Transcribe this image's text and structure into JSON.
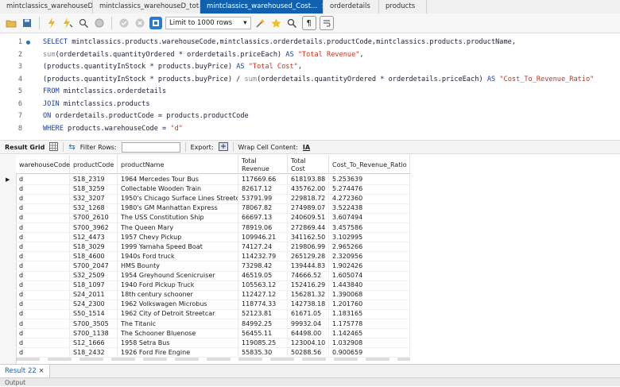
{
  "tabs": [
    {
      "label": "mintclassics_warehouseD",
      "close": ""
    },
    {
      "label": "mintclassics_warehouseD_total...",
      "close": ""
    },
    {
      "label": "mintclassics_warehoused_Cost...",
      "close": "×"
    },
    {
      "label": "orderdetails",
      "close": ""
    },
    {
      "label": "products",
      "close": ""
    }
  ],
  "toolbar": {
    "limit_label": "Limit to 1000 rows",
    "icons": [
      "folder-icon",
      "save-icon",
      "lightning-icon",
      "lightning-cursor-icon",
      "magnifier-icon",
      "stop-icon",
      "check-icon",
      "cancel-icon",
      "toggle-icon",
      "limit-dropdown",
      "beautify-icon",
      "star-icon",
      "search-icon",
      "invisible-chars-icon",
      "wrap-icon"
    ]
  },
  "editor": {
    "lines": [
      {
        "n": "1",
        "parts": [
          [
            "kw",
            "SELECT "
          ],
          [
            "t",
            "mintclassics.products.warehouseCode,mintclassics.orderdetails.productCode,mintclassics.products.productName,"
          ]
        ]
      },
      {
        "n": "2",
        "parts": [
          [
            "fn",
            "sum"
          ],
          [
            "t",
            "(orderdetails.quantityOrdered * orderdetails.priceEach) "
          ],
          [
            "kw",
            "AS "
          ],
          [
            "str",
            "\"Total Revenue\""
          ],
          [
            "t",
            ","
          ]
        ]
      },
      {
        "n": "3",
        "parts": [
          [
            "t",
            "(products.quantityInStock * products.buyPrice) "
          ],
          [
            "kw",
            "AS "
          ],
          [
            "str",
            "\"Total Cost\""
          ],
          [
            "t",
            ","
          ]
        ]
      },
      {
        "n": "4",
        "parts": [
          [
            "t",
            "(products.quantityInStock * products.buyPrice) / "
          ],
          [
            "fn",
            "sum"
          ],
          [
            "t",
            "(orderdetails.quantityOrdered * orderdetails.priceEach) "
          ],
          [
            "kw",
            "AS "
          ],
          [
            "str",
            "\"Cost_To_Revenue_Ratio\""
          ]
        ]
      },
      {
        "n": "5",
        "parts": [
          [
            "kw",
            "FROM "
          ],
          [
            "t",
            "mintclassics.orderdetails"
          ]
        ]
      },
      {
        "n": "6",
        "parts": [
          [
            "kw",
            "JOIN "
          ],
          [
            "t",
            "mintclassics.products"
          ]
        ]
      },
      {
        "n": "7",
        "parts": [
          [
            "kw",
            "ON "
          ],
          [
            "t",
            "orderdetails.productCode = products.productCode"
          ]
        ]
      },
      {
        "n": "8",
        "parts": [
          [
            "kw",
            "WHERE "
          ],
          [
            "t",
            "products.warehouseCode = "
          ],
          [
            "str",
            "\"d\""
          ]
        ]
      }
    ]
  },
  "result_bar": {
    "result_grid": "Result Grid",
    "filter_rows": "Filter Rows:",
    "export": "Export:",
    "wrap_cell": "Wrap Cell Content:",
    "wrap_icon": "IA"
  },
  "grid": {
    "columns": [
      "warehouseCode",
      "productCode",
      "productName",
      "Total\nRevenue",
      "Total\nCost",
      "Cost_To_Revenue_Ratio"
    ],
    "rows": [
      [
        "d",
        "S18_2319",
        "1964 Mercedes Tour Bus",
        "117669.66",
        "618193.88",
        "5.253639"
      ],
      [
        "d",
        "S18_3259",
        "Collectable Wooden Train",
        "82617.12",
        "435762.00",
        "5.274476"
      ],
      [
        "d",
        "S32_3207",
        "1950's Chicago Surface Lines Streetcar",
        "53791.99",
        "229818.72",
        "4.272360"
      ],
      [
        "d",
        "S32_1268",
        "1980's GM Manhattan Express",
        "78067.82",
        "274989.07",
        "3.522438"
      ],
      [
        "d",
        "S700_2610",
        "The USS Constitution Ship",
        "66697.13",
        "240609.51",
        "3.607494"
      ],
      [
        "d",
        "S700_3962",
        "The Queen Mary",
        "78919.06",
        "272869.44",
        "3.457586"
      ],
      [
        "d",
        "S12_4473",
        "1957 Chevy Pickup",
        "109946.21",
        "341162.50",
        "3.102995"
      ],
      [
        "d",
        "S18_3029",
        "1999 Yamaha Speed Boat",
        "74127.24",
        "219806.99",
        "2.965266"
      ],
      [
        "d",
        "S18_4600",
        "1940s Ford truck",
        "114232.79",
        "265129.28",
        "2.320956"
      ],
      [
        "d",
        "S700_2047",
        "HMS Bounty",
        "73298.42",
        "139444.83",
        "1.902426"
      ],
      [
        "d",
        "S32_2509",
        "1954 Greyhound Scenicruiser",
        "46519.05",
        "74666.52",
        "1.605074"
      ],
      [
        "d",
        "S18_1097",
        "1940 Ford Pickup Truck",
        "105563.12",
        "152416.29",
        "1.443840"
      ],
      [
        "d",
        "S24_2011",
        "18th century schooner",
        "112427.12",
        "156281.32",
        "1.390068"
      ],
      [
        "d",
        "S24_2300",
        "1962 Volkswagen Microbus",
        "118774.33",
        "142738.18",
        "1.201760"
      ],
      [
        "d",
        "S50_1514",
        "1962 City of Detroit Streetcar",
        "52123.81",
        "61671.05",
        "1.183165"
      ],
      [
        "d",
        "S700_3505",
        "The Titanic",
        "84992.25",
        "99932.04",
        "1.175778"
      ],
      [
        "d",
        "S700_1138",
        "The Schooner Bluenose",
        "56455.11",
        "64498.00",
        "1.142465"
      ],
      [
        "d",
        "S12_1666",
        "1958 Setra Bus",
        "119085.25",
        "123004.10",
        "1.032908"
      ],
      [
        "d",
        "S18_2432",
        "1926 Ford Fire Engine",
        "55835.30",
        "50288.56",
        "0.900659"
      ]
    ]
  },
  "bottom_tabs": {
    "result": "Result 22",
    "close": "×"
  },
  "output_label": "Output"
}
